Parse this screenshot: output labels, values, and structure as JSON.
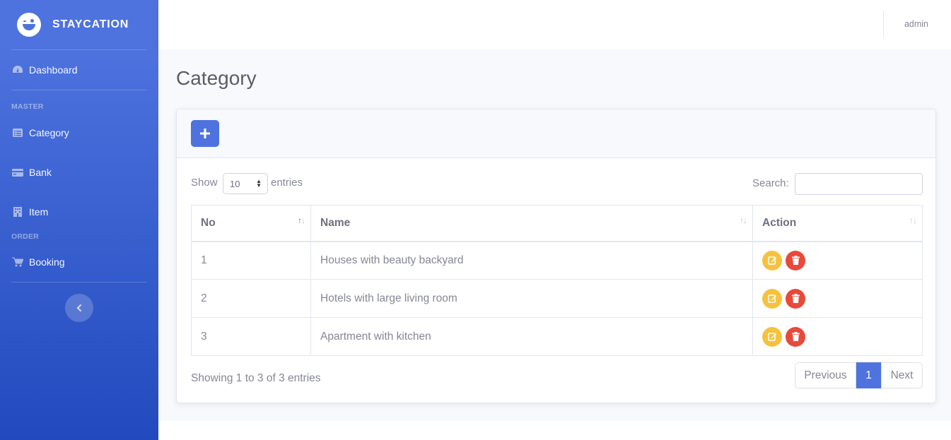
{
  "brand": {
    "name": "STAYCATION"
  },
  "sidebar": {
    "items": [
      {
        "label": "Dashboard",
        "icon": "tachometer-icon"
      },
      {
        "label": "Category",
        "icon": "list-icon"
      },
      {
        "label": "Bank",
        "icon": "credit-card-icon"
      },
      {
        "label": "Item",
        "icon": "building-icon"
      },
      {
        "label": "Booking",
        "icon": "cart-icon"
      }
    ],
    "headings": {
      "master": "MASTER",
      "order": "ORDER"
    },
    "toggle_icon": "chevron-left-icon"
  },
  "topbar": {
    "user": "admin"
  },
  "page": {
    "title": "Category"
  },
  "table_controls": {
    "show_label": "Show",
    "length_value": "10",
    "entries_label": "entries",
    "search_label": "Search:",
    "search_value": ""
  },
  "table": {
    "headers": [
      "No",
      "Name",
      "Action"
    ],
    "rows": [
      {
        "no": "1",
        "name": "Houses with beauty backyard"
      },
      {
        "no": "2",
        "name": "Hotels with large living room"
      },
      {
        "no": "3",
        "name": "Apartment with kitchen"
      }
    ]
  },
  "footer": {
    "info": "Showing 1 to 3 of 3 entries",
    "pagination": {
      "previous": "Previous",
      "current": "1",
      "next": "Next"
    }
  },
  "colors": {
    "primary": "#4e73df",
    "warning": "#f6c23e",
    "danger": "#e74a3b"
  }
}
